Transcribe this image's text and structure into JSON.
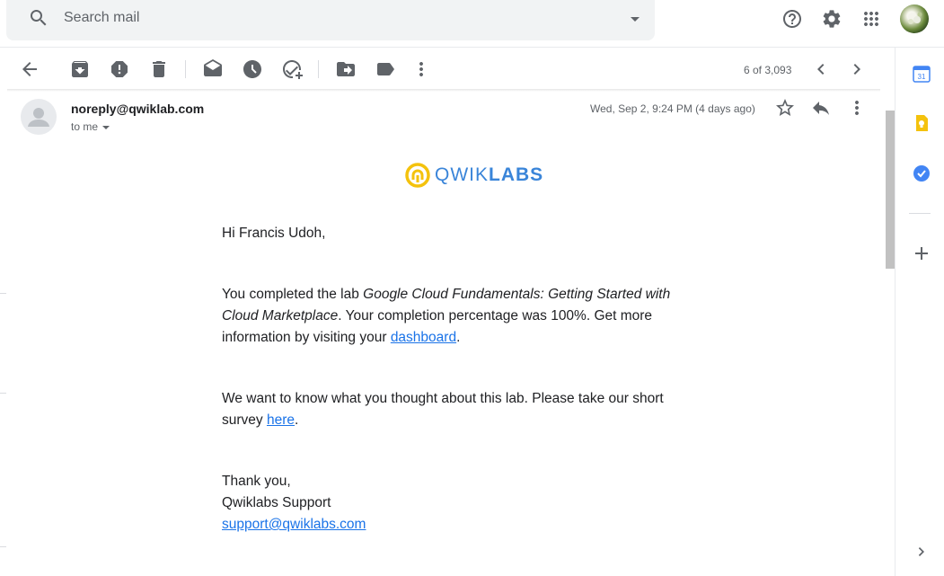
{
  "search": {
    "placeholder": "Search mail"
  },
  "toolbar": {
    "page_counter": "6 of 3,093"
  },
  "message": {
    "sender": "noreply@qwiklab.com",
    "recipient": "to me",
    "date": "Wed, Sep 2, 9:24 PM (4 days ago)"
  },
  "logo": {
    "text_light": "QWIK",
    "text_bold": "LABS"
  },
  "body": {
    "greeting": "Hi Francis Udoh,",
    "p1_before": "You completed the lab ",
    "p1_lab_name": "Google Cloud Fundamentals: Getting Started with Cloud Marketplace",
    "p1_after": ". Your completion percentage was 100%. Get more information by visiting your ",
    "p1_link": "dashboard",
    "p1_end": ".",
    "p2_before": "We want to know what you thought about this lab. Please take our short survey ",
    "p2_link": "here",
    "p2_end": ".",
    "signoff": "Thank you,",
    "signature": "Qwiklabs Support",
    "support_email": "support@qwiklabs.com"
  },
  "side_panel": {
    "calendar_day": "31"
  },
  "colors": {
    "link": "#1a73e8",
    "accent_yellow": "#f4c20d",
    "accent_blue": "#4285f4"
  }
}
